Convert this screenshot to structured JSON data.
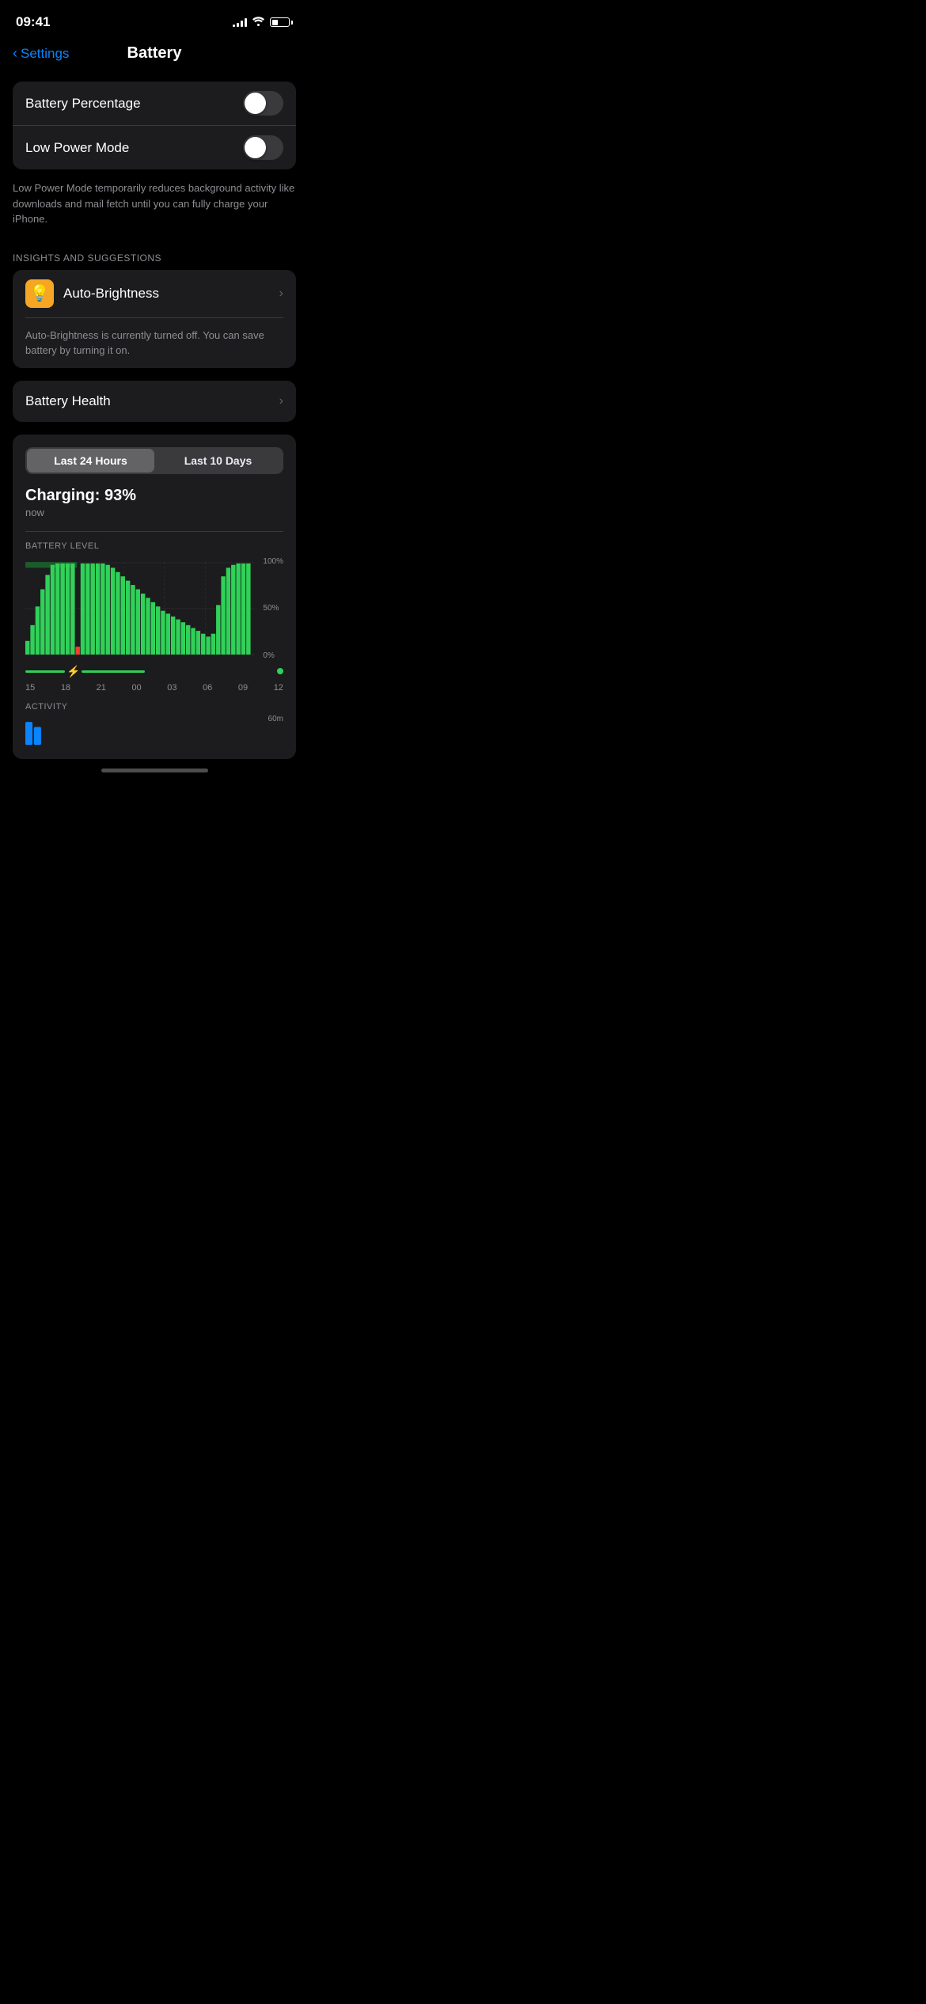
{
  "status": {
    "time": "09:41",
    "signal_bars": [
      3,
      5,
      7,
      9,
      11
    ],
    "battery_level_pct": 35
  },
  "nav": {
    "back_label": "Settings",
    "title": "Battery"
  },
  "settings_section": {
    "rows": [
      {
        "id": "battery-percentage",
        "label": "Battery Percentage",
        "toggle": false
      },
      {
        "id": "low-power-mode",
        "label": "Low Power Mode",
        "toggle": false
      }
    ],
    "description": "Low Power Mode temporarily reduces background activity like downloads and mail fetch until you can fully charge your iPhone."
  },
  "insights_section": {
    "header": "INSIGHTS AND SUGGESTIONS",
    "item": {
      "label": "Auto-Brightness",
      "description": "Auto-Brightness is currently turned off. You can save battery by turning it on."
    }
  },
  "battery_health": {
    "label": "Battery Health"
  },
  "chart_section": {
    "tabs": [
      "Last 24 Hours",
      "Last 10 Days"
    ],
    "active_tab": 0,
    "charging_title": "Charging: 93%",
    "charging_sub": "now",
    "battery_level_label": "BATTERY LEVEL",
    "y_labels": [
      "100%",
      "50%",
      "0%"
    ],
    "x_labels": [
      "15",
      "18",
      "21",
      "00",
      "03",
      "06",
      "09",
      "12"
    ],
    "activity_label": "ACTIVITY",
    "activity_y_label": "60m"
  }
}
